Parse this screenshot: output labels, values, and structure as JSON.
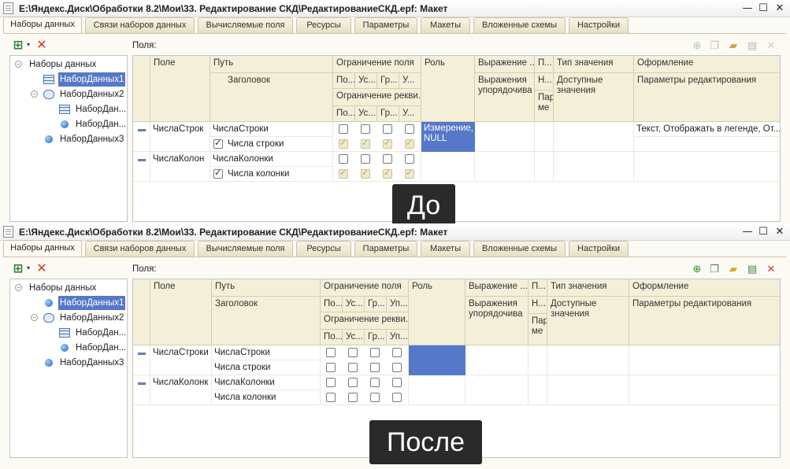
{
  "window_title": "E:\\Яндекс.Диск\\Обработки 8.2\\Мои\\33. Редактирование СКД\\РедактированиеСКД.epf: Макет",
  "window_controls": {
    "minimize": "—",
    "maximize": "☐",
    "close": "✕"
  },
  "tabs": [
    "Наборы данных",
    "Связи наборов данных",
    "Вычисляемые поля",
    "Ресурсы",
    "Параметры",
    "Макеты",
    "Вложенные схемы",
    "Настройки"
  ],
  "fields_label": "Поля:",
  "tree": {
    "root": "Наборы данных",
    "items": [
      "НаборДанных1",
      "НаборДанных2",
      "НаборДан...",
      "НаборДан...",
      "НаборДанных3"
    ]
  },
  "grid": {
    "headers": {
      "field": "Поле",
      "path": "Путь",
      "title": "Заголовок",
      "restrict_field": "Ограничение поля",
      "restrict_req": "Ограничение рекви...",
      "rf_top": [
        "По...",
        "Ус...",
        "Гр...",
        "У..."
      ],
      "rf_bottom": [
        "По...",
        "Ус...",
        "Гр...",
        "У..."
      ],
      "role": "Роль",
      "expression": "Выражение ...",
      "order_expr": "Выражения упорядочива",
      "p": "П...",
      "h": "Н...",
      "param": "Пара ме",
      "value_type": "Тип значения",
      "available_values": "Доступные значения",
      "format": "Оформление",
      "edit_params": "Параметры редактирования"
    },
    "after_rf_top": [
      "По...",
      "Ус...",
      "Гр...",
      "Уп..."
    ],
    "after_rf_bottom": [
      "По...",
      "Ус...",
      "Гр...",
      "Уп..."
    ],
    "after_restrict_req": "Ограничение рекви..."
  },
  "before": {
    "caption": "До",
    "rows": [
      {
        "field": "ЧислаСтрок",
        "path": "ЧислаСтроки",
        "title": "Числа строки",
        "role": "Измерение, NULL",
        "format": "Текст, Отображать в легенде, От..."
      },
      {
        "field": "ЧислаКолон",
        "path": "ЧислаКолонки",
        "title": "Числа колонки"
      }
    ]
  },
  "after": {
    "caption": "После",
    "rows": [
      {
        "field": "ЧислаСтроки",
        "path": "ЧислаСтроки",
        "title": "Числа строки"
      },
      {
        "field": "ЧислаКолонк",
        "path": "ЧислаКолонки",
        "title": "Числа колонки"
      }
    ]
  },
  "icons": {
    "add": "add-icon",
    "delete": "delete-icon",
    "add-field": "add-field-icon",
    "add-folder": "add-folder-icon",
    "copy": "copy-icon",
    "table": "table-icon",
    "union": "union-icon",
    "object": "object-icon"
  },
  "colors": {
    "accent": "#5578c9",
    "header_bg": "#f4efd9",
    "panel_bg": "#fbfaf4",
    "caption_bg": "#2a2a2a"
  }
}
